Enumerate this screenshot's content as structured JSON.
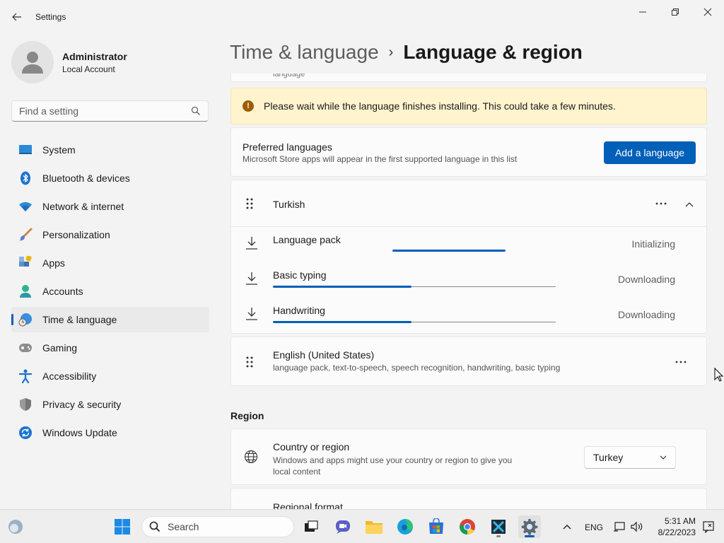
{
  "window": {
    "title": "Settings"
  },
  "profile": {
    "name": "Administrator",
    "account_type": "Local Account"
  },
  "search": {
    "placeholder": "Find a setting"
  },
  "sidebar": {
    "items": [
      {
        "label": "System",
        "icon": "system-icon"
      },
      {
        "label": "Bluetooth & devices",
        "icon": "bluetooth-icon"
      },
      {
        "label": "Network & internet",
        "icon": "wifi-icon"
      },
      {
        "label": "Personalization",
        "icon": "brush-icon"
      },
      {
        "label": "Apps",
        "icon": "apps-icon"
      },
      {
        "label": "Accounts",
        "icon": "accounts-icon"
      },
      {
        "label": "Time & language",
        "icon": "time-language-icon",
        "active": true
      },
      {
        "label": "Gaming",
        "icon": "gamepad-icon"
      },
      {
        "label": "Accessibility",
        "icon": "accessibility-icon"
      },
      {
        "label": "Privacy & security",
        "icon": "shield-icon"
      },
      {
        "label": "Windows Update",
        "icon": "update-icon"
      }
    ]
  },
  "breadcrumb": {
    "parent": "Time & language",
    "separator": "›",
    "current": "Language & region"
  },
  "main": {
    "top_remnant": "language",
    "warning": "Please wait while the language finishes installing. This could take a few minutes.",
    "preferred": {
      "title": "Preferred languages",
      "subtitle": "Microsoft Store apps will appear in the first supported language in this list",
      "add_button": "Add a language"
    },
    "turkish": {
      "name": "Turkish",
      "features": [
        {
          "label": "Language pack",
          "status": "Initializing",
          "progress": null
        },
        {
          "label": "Basic typing",
          "status": "Downloading",
          "progress": 0.49
        },
        {
          "label": "Handwriting",
          "status": "Downloading",
          "progress": 0.49
        }
      ]
    },
    "english": {
      "name": "English (United States)",
      "subtitle": "language pack, text-to-speech, speech recognition, handwriting, basic typing"
    },
    "region": {
      "section_title": "Region",
      "country": {
        "title": "Country or region",
        "subtitle": "Windows and apps might use your country or region to give you local content",
        "value": "Turkey"
      },
      "format": {
        "title": "Regional format"
      }
    }
  },
  "taskbar": {
    "search_label": "Search",
    "language": "ENG",
    "time": "5:31 AM",
    "date": "8/22/2023"
  },
  "colors": {
    "accent": "#005fb8",
    "warning_bg": "#fff4ce",
    "warning_icon": "#9d5d00"
  }
}
